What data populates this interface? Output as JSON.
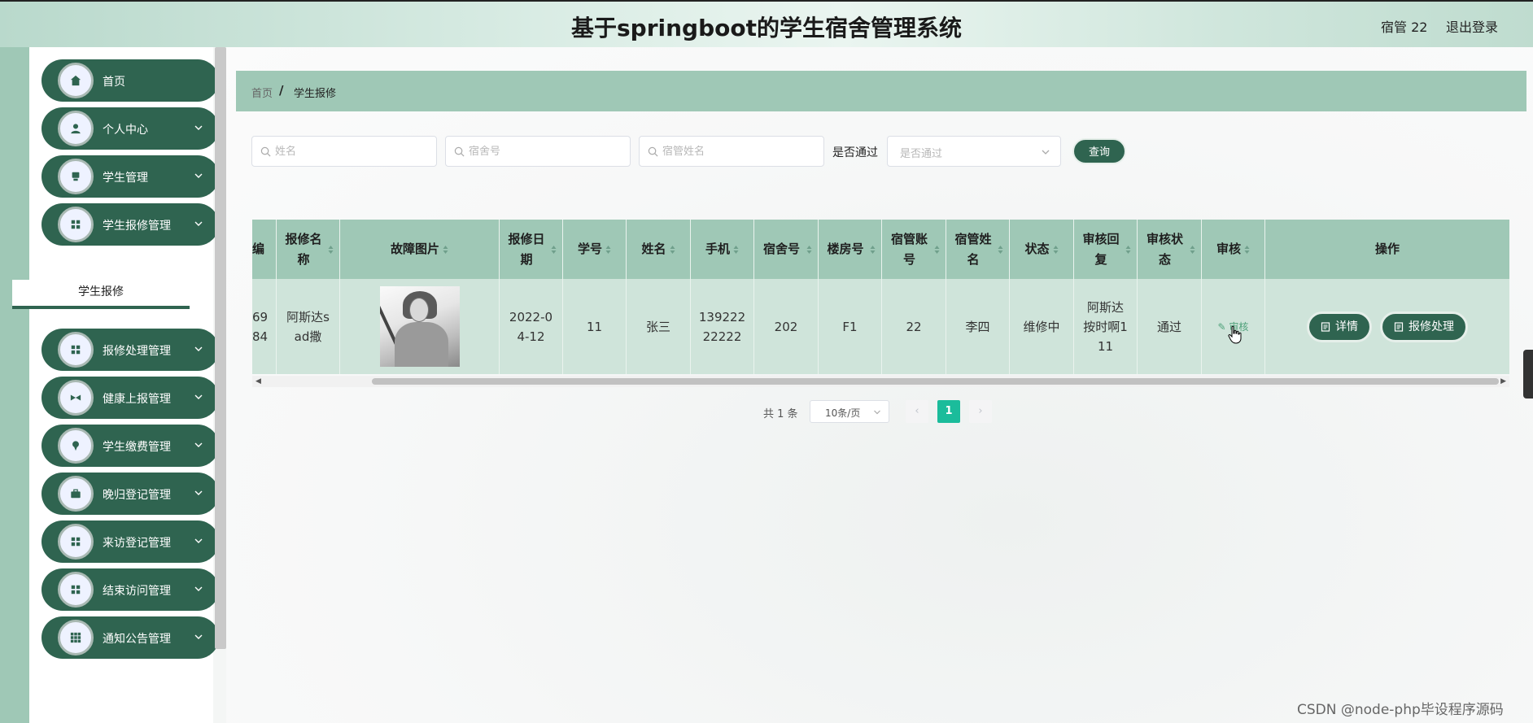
{
  "header": {
    "title": "基于springboot的学生宿舍管理系统",
    "user": "宿管 22",
    "logout": "退出登录"
  },
  "sidebar": {
    "items": [
      {
        "label": "首页",
        "icon": "home-icon",
        "expandable": false
      },
      {
        "label": "个人中心",
        "icon": "user-icon",
        "expandable": true
      },
      {
        "label": "学生管理",
        "icon": "student-icon",
        "expandable": true
      },
      {
        "label": "学生报修管理",
        "icon": "grid-icon",
        "expandable": true
      },
      {
        "label": "报修处理管理",
        "icon": "grid-icon",
        "expandable": true
      },
      {
        "label": "健康上报管理",
        "icon": "health-icon",
        "expandable": true
      },
      {
        "label": "学生缴费管理",
        "icon": "pin-icon",
        "expandable": true
      },
      {
        "label": "晚归登记管理",
        "icon": "briefcase-icon",
        "expandable": true
      },
      {
        "label": "来访登记管理",
        "icon": "grid-icon",
        "expandable": true
      },
      {
        "label": "结束访问管理",
        "icon": "grid-icon",
        "expandable": true
      },
      {
        "label": "通知公告管理",
        "icon": "apps-icon",
        "expandable": true
      }
    ],
    "submenu_active": "学生报修"
  },
  "breadcrumb": {
    "home": "首页",
    "separator": "/",
    "current": "学生报修"
  },
  "search": {
    "name_placeholder": "姓名",
    "dorm_placeholder": "宿舍号",
    "manager_placeholder": "宿管姓名",
    "pass_label": "是否通过",
    "pass_placeholder": "是否通过",
    "query_label": "查询"
  },
  "table": {
    "headers": [
      "编",
      "报修名称",
      "故障图片",
      "报修日期",
      "学号",
      "姓名",
      "手机",
      "宿舍号",
      "楼房号",
      "宿管账号",
      "宿管姓名",
      "状态",
      "审核回复",
      "审核状态",
      "审核",
      "操作"
    ],
    "row": {
      "id": "6984",
      "repair_name": "阿斯达sad撒",
      "date": "2022-04-12",
      "student_no": "11",
      "name": "张三",
      "phone": "13922222222",
      "dorm": "202",
      "building": "F1",
      "manager_account": "22",
      "manager_name": "李四",
      "status": "维修中",
      "reply": "阿斯达按时啊111",
      "audit_status": "通过",
      "audit_link": "审核",
      "detail_btn": "详情",
      "process_btn": "报修处理"
    }
  },
  "pagination": {
    "total": "共 1 条",
    "page_size": "10条/页",
    "current_page": "1",
    "prev": "‹",
    "next": "›"
  },
  "watermark": "CSDN @node-php毕设程序源码",
  "colors": {
    "primary": "#2f6450",
    "header_bg": "#9fc8b6",
    "row_bg": "#cfe4da",
    "page_active": "#1bbc9b"
  }
}
